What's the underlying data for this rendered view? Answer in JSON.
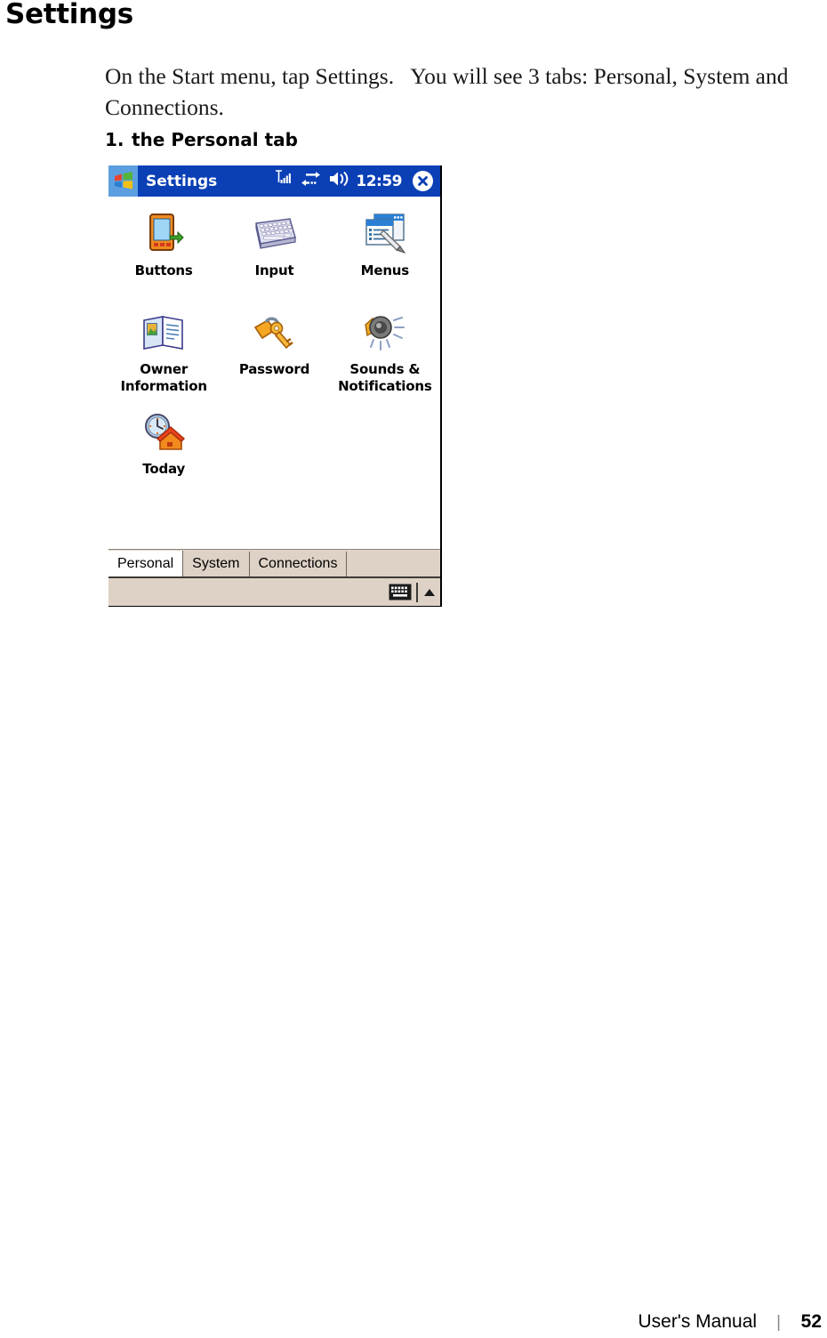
{
  "page": {
    "heading": "Settings",
    "paragraph": "On the Start menu, tap Settings.   You will see 3 tabs: Personal, System and Connections.",
    "list": [
      {
        "number": "1.",
        "text": "the Personal tab"
      }
    ]
  },
  "pda": {
    "titlebar": {
      "start_icon": "windows-flag-icon",
      "title": "Settings",
      "signal_icon": "signal-strength-icon",
      "connectivity_icon": "connectivity-icon",
      "volume_icon": "speaker-volume-icon",
      "clock": "12:59",
      "close_icon": "close-circle-icon"
    },
    "icons": [
      {
        "label": "Buttons",
        "icon": "pda-device-icon"
      },
      {
        "label": "Input",
        "icon": "keyboard-icon"
      },
      {
        "label": "Menus",
        "icon": "menu-window-stylus-icon"
      },
      {
        "label": "Owner\nInformation",
        "icon": "owner-card-icon"
      },
      {
        "label": "Password",
        "icon": "padlock-key-icon"
      },
      {
        "label": "Sounds &\nNotifications",
        "icon": "speaker-sounds-icon"
      },
      {
        "label": "Today",
        "icon": "clock-house-icon"
      }
    ],
    "tabs": [
      {
        "label": "Personal",
        "active": true
      },
      {
        "label": "System",
        "active": false
      },
      {
        "label": "Connections",
        "active": false
      }
    ],
    "sipbar": {
      "keyboard_icon": "soft-keyboard-icon",
      "arrow_icon": "sip-chevron-up-icon"
    },
    "colors": {
      "titlebar_blue": "#0a3fb5",
      "start_button_blue": "#5b9fe0",
      "tab_beige": "#ded2c6",
      "screen_white": "#ffffff"
    }
  },
  "footer": {
    "manual_label": "User's Manual",
    "separator": "|",
    "page_number": "52"
  }
}
